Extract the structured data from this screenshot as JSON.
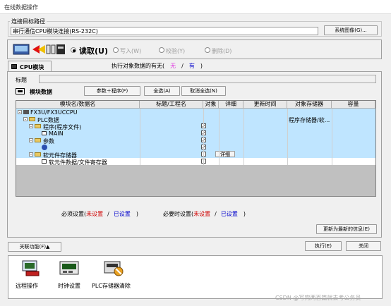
{
  "window": {
    "title": "在线数据操作"
  },
  "connection": {
    "legend": "连接目标路径",
    "value": "串行通信CPU模块连接(RS-232C)",
    "system_image_button": "系统图像(G)..."
  },
  "operation": {
    "read": "读取(U)",
    "write": "写入(W)",
    "verify": "校验(Y)",
    "delete": "删除(D)"
  },
  "tab": {
    "label": "CPU模块"
  },
  "target_presence": {
    "label": "执行对象数据的有无(",
    "none": "无",
    "sep": "/",
    "yes": "有",
    "close": ")"
  },
  "title_label": "标题",
  "module_data": {
    "label": "模块数据",
    "param_program_button": "参数＋程序(F)",
    "select_all_button": "全选(A)",
    "deselect_all_button": "取消全选(N)"
  },
  "table": {
    "headers": [
      "模块名/数据名",
      "标题/工程名",
      "对象",
      "详细",
      "更新时间",
      "对象存储器",
      "容量"
    ],
    "rows": [
      {
        "name": "FX3U/FX3UCCPU",
        "memory": ""
      },
      {
        "name": "PLC数据",
        "memory": "程序存储器/软..."
      },
      {
        "name": "程序(程序文件)",
        "memory": ""
      },
      {
        "name": "MAIN",
        "memory": ""
      },
      {
        "name": "参数",
        "memory": ""
      },
      {
        "name": "",
        "memory": ""
      },
      {
        "name": "软元件存储器",
        "memory": ""
      },
      {
        "name": "软元件数据/文件寄存器",
        "memory": ""
      }
    ],
    "detail_button": "详细"
  },
  "status": {
    "required_label": "必须设置(",
    "unset": "未设置",
    "slash": "/",
    "set": "已设置",
    "close": ")",
    "when_needed_label": "必要时设置("
  },
  "update_button": "更新为最新的信息(E)",
  "related_button": "关联功能(F)▲",
  "execute_button": "执行(E)",
  "close_button": "关闭",
  "tools": {
    "remote": "远程操作",
    "clock": "时钟设置",
    "clear": "PLC存储器清除"
  },
  "watermark": "CSDN @写完两百篇就去考公务员",
  "colors": {
    "selected_row": "#bfe5ff",
    "grid_bg": "#c0c0c0",
    "red": "#d00000",
    "blue": "#0000cc"
  }
}
